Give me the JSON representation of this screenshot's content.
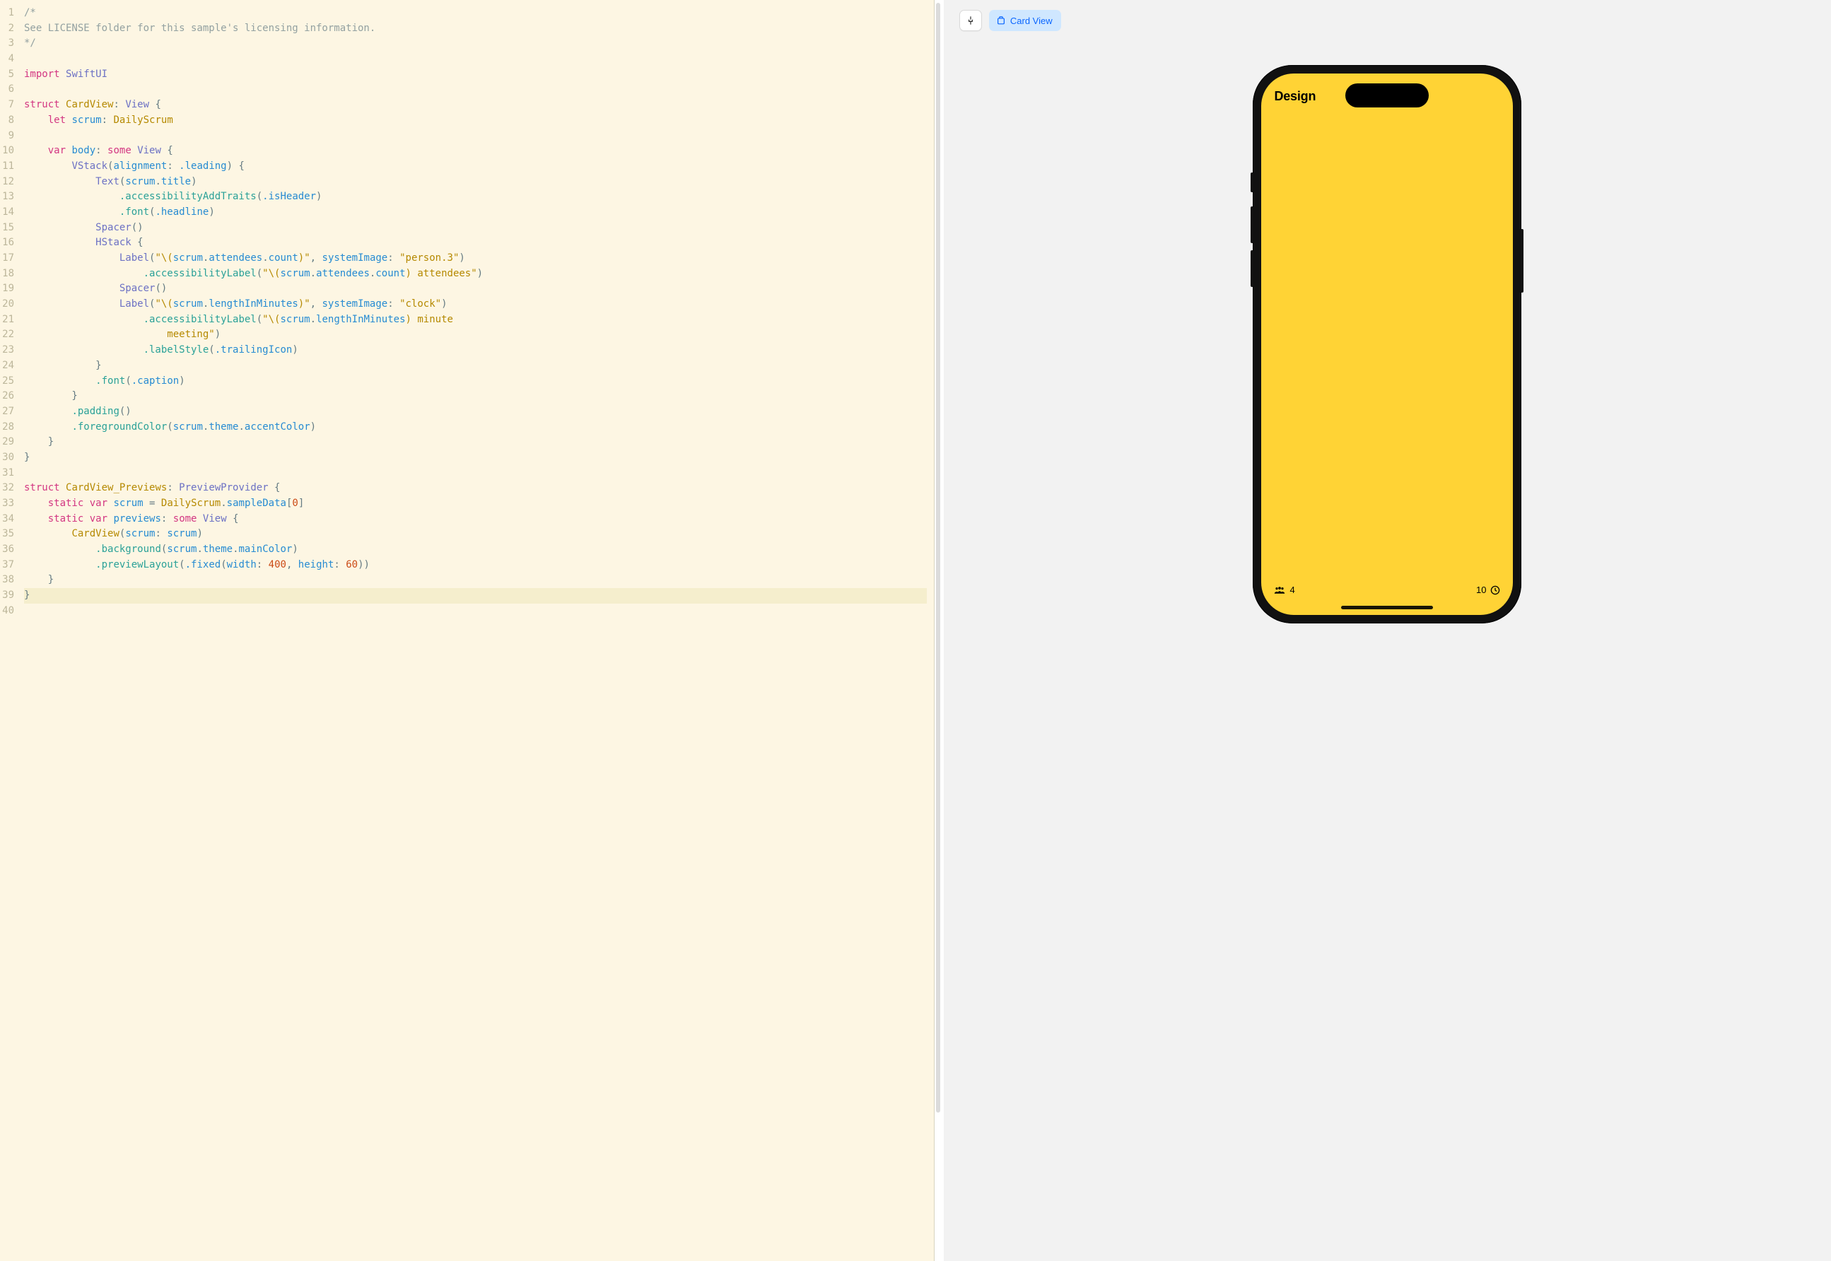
{
  "editor": {
    "lineCount": 39,
    "highlightLine": 39,
    "lines": [
      [
        [
          "c-comment",
          "/*"
        ]
      ],
      [
        [
          "c-comment",
          "See LICENSE folder for this sample's licensing information."
        ]
      ],
      [
        [
          "c-comment",
          "*/"
        ]
      ],
      [],
      [
        [
          "c-keyword",
          "import"
        ],
        [
          "c-plain",
          " "
        ],
        [
          "c-type",
          "SwiftUI"
        ]
      ],
      [],
      [
        [
          "c-keyword",
          "struct"
        ],
        [
          "c-plain",
          " "
        ],
        [
          "c-name",
          "CardView"
        ],
        [
          "c-plain",
          ": "
        ],
        [
          "c-type",
          "View"
        ],
        [
          "c-plain",
          " {"
        ]
      ],
      [
        [
          "c-plain",
          "    "
        ],
        [
          "c-keyword",
          "let"
        ],
        [
          "c-plain",
          " "
        ],
        [
          "c-ident",
          "scrum"
        ],
        [
          "c-plain",
          ": "
        ],
        [
          "c-name",
          "DailyScrum"
        ]
      ],
      [],
      [
        [
          "c-plain",
          "    "
        ],
        [
          "c-keyword",
          "var"
        ],
        [
          "c-plain",
          " "
        ],
        [
          "c-ident",
          "body"
        ],
        [
          "c-plain",
          ": "
        ],
        [
          "c-keyword",
          "some"
        ],
        [
          "c-plain",
          " "
        ],
        [
          "c-type",
          "View"
        ],
        [
          "c-plain",
          " {"
        ]
      ],
      [
        [
          "c-plain",
          "        "
        ],
        [
          "c-type",
          "VStack"
        ],
        [
          "c-plain",
          "("
        ],
        [
          "c-ident",
          "alignment"
        ],
        [
          "c-plain",
          ": "
        ],
        [
          "c-enum",
          ".leading"
        ],
        [
          "c-plain",
          ") {"
        ]
      ],
      [
        [
          "c-plain",
          "            "
        ],
        [
          "c-type",
          "Text"
        ],
        [
          "c-plain",
          "("
        ],
        [
          "c-ident",
          "scrum"
        ],
        [
          "c-plain",
          "."
        ],
        [
          "c-ident",
          "title"
        ],
        [
          "c-plain",
          ")"
        ]
      ],
      [
        [
          "c-plain",
          "                "
        ],
        [
          "c-member",
          ".accessibilityAddTraits"
        ],
        [
          "c-plain",
          "("
        ],
        [
          "c-enum",
          ".isHeader"
        ],
        [
          "c-plain",
          ")"
        ]
      ],
      [
        [
          "c-plain",
          "                "
        ],
        [
          "c-member",
          ".font"
        ],
        [
          "c-plain",
          "("
        ],
        [
          "c-enum",
          ".headline"
        ],
        [
          "c-plain",
          ")"
        ]
      ],
      [
        [
          "c-plain",
          "            "
        ],
        [
          "c-type",
          "Spacer"
        ],
        [
          "c-plain",
          "()"
        ]
      ],
      [
        [
          "c-plain",
          "            "
        ],
        [
          "c-type",
          "HStack"
        ],
        [
          "c-plain",
          " {"
        ]
      ],
      [
        [
          "c-plain",
          "                "
        ],
        [
          "c-type",
          "Label"
        ],
        [
          "c-plain",
          "("
        ],
        [
          "c-string",
          "\"\\("
        ],
        [
          "c-ident",
          "scrum"
        ],
        [
          "c-plain",
          "."
        ],
        [
          "c-ident",
          "attendees"
        ],
        [
          "c-plain",
          "."
        ],
        [
          "c-ident",
          "count"
        ],
        [
          "c-string",
          ")\""
        ],
        [
          "c-plain",
          ", "
        ],
        [
          "c-ident",
          "systemImage"
        ],
        [
          "c-plain",
          ": "
        ],
        [
          "c-string",
          "\"person.3\""
        ],
        [
          "c-plain",
          ")"
        ]
      ],
      [
        [
          "c-plain",
          "                    "
        ],
        [
          "c-member",
          ".accessibilityLabel"
        ],
        [
          "c-plain",
          "("
        ],
        [
          "c-string",
          "\"\\("
        ],
        [
          "c-ident",
          "scrum"
        ],
        [
          "c-plain",
          "."
        ],
        [
          "c-ident",
          "attendees"
        ],
        [
          "c-plain",
          "."
        ],
        [
          "c-ident",
          "count"
        ],
        [
          "c-string",
          ") attendees\""
        ],
        [
          "c-plain",
          ")"
        ]
      ],
      [
        [
          "c-plain",
          "                "
        ],
        [
          "c-type",
          "Spacer"
        ],
        [
          "c-plain",
          "()"
        ]
      ],
      [
        [
          "c-plain",
          "                "
        ],
        [
          "c-type",
          "Label"
        ],
        [
          "c-plain",
          "("
        ],
        [
          "c-string",
          "\"\\("
        ],
        [
          "c-ident",
          "scrum"
        ],
        [
          "c-plain",
          "."
        ],
        [
          "c-ident",
          "lengthInMinutes"
        ],
        [
          "c-string",
          ")\""
        ],
        [
          "c-plain",
          ", "
        ],
        [
          "c-ident",
          "systemImage"
        ],
        [
          "c-plain",
          ": "
        ],
        [
          "c-string",
          "\"clock\""
        ],
        [
          "c-plain",
          ")"
        ]
      ],
      [
        [
          "c-plain",
          "                    "
        ],
        [
          "c-member",
          ".accessibilityLabel"
        ],
        [
          "c-plain",
          "("
        ],
        [
          "c-string",
          "\"\\("
        ],
        [
          "c-ident",
          "scrum"
        ],
        [
          "c-plain",
          "."
        ],
        [
          "c-ident",
          "lengthInMinutes"
        ],
        [
          "c-string",
          ") minute "
        ]
      ],
      [
        [
          "c-string",
          "                        meeting\""
        ],
        [
          "c-plain",
          ")"
        ]
      ],
      [
        [
          "c-plain",
          "                    "
        ],
        [
          "c-member",
          ".labelStyle"
        ],
        [
          "c-plain",
          "("
        ],
        [
          "c-enum",
          ".trailingIcon"
        ],
        [
          "c-plain",
          ")"
        ]
      ],
      [
        [
          "c-plain",
          "            }"
        ]
      ],
      [
        [
          "c-plain",
          "            "
        ],
        [
          "c-member",
          ".font"
        ],
        [
          "c-plain",
          "("
        ],
        [
          "c-enum",
          ".caption"
        ],
        [
          "c-plain",
          ")"
        ]
      ],
      [
        [
          "c-plain",
          "        }"
        ]
      ],
      [
        [
          "c-plain",
          "        "
        ],
        [
          "c-member",
          ".padding"
        ],
        [
          "c-plain",
          "()"
        ]
      ],
      [
        [
          "c-plain",
          "        "
        ],
        [
          "c-member",
          ".foregroundColor"
        ],
        [
          "c-plain",
          "("
        ],
        [
          "c-ident",
          "scrum"
        ],
        [
          "c-plain",
          "."
        ],
        [
          "c-ident",
          "theme"
        ],
        [
          "c-plain",
          "."
        ],
        [
          "c-ident",
          "accentColor"
        ],
        [
          "c-plain",
          ")"
        ]
      ],
      [
        [
          "c-plain",
          "    }"
        ]
      ],
      [
        [
          "c-plain",
          "}"
        ]
      ],
      [],
      [
        [
          "c-keyword",
          "struct"
        ],
        [
          "c-plain",
          " "
        ],
        [
          "c-name",
          "CardView_Previews"
        ],
        [
          "c-plain",
          ": "
        ],
        [
          "c-type",
          "PreviewProvider"
        ],
        [
          "c-plain",
          " {"
        ]
      ],
      [
        [
          "c-plain",
          "    "
        ],
        [
          "c-keyword",
          "static"
        ],
        [
          "c-plain",
          " "
        ],
        [
          "c-keyword",
          "var"
        ],
        [
          "c-plain",
          " "
        ],
        [
          "c-ident",
          "scrum"
        ],
        [
          "c-plain",
          " = "
        ],
        [
          "c-name",
          "DailyScrum"
        ],
        [
          "c-plain",
          "."
        ],
        [
          "c-ident",
          "sampleData"
        ],
        [
          "c-plain",
          "["
        ],
        [
          "c-number",
          "0"
        ],
        [
          "c-plain",
          "]"
        ]
      ],
      [
        [
          "c-plain",
          "    "
        ],
        [
          "c-keyword",
          "static"
        ],
        [
          "c-plain",
          " "
        ],
        [
          "c-keyword",
          "var"
        ],
        [
          "c-plain",
          " "
        ],
        [
          "c-ident",
          "previews"
        ],
        [
          "c-plain",
          ": "
        ],
        [
          "c-keyword",
          "some"
        ],
        [
          "c-plain",
          " "
        ],
        [
          "c-type",
          "View"
        ],
        [
          "c-plain",
          " {"
        ]
      ],
      [
        [
          "c-plain",
          "        "
        ],
        [
          "c-name",
          "CardView"
        ],
        [
          "c-plain",
          "("
        ],
        [
          "c-ident",
          "scrum"
        ],
        [
          "c-plain",
          ": "
        ],
        [
          "c-ident",
          "scrum"
        ],
        [
          "c-plain",
          ")"
        ]
      ],
      [
        [
          "c-plain",
          "            "
        ],
        [
          "c-member",
          ".background"
        ],
        [
          "c-plain",
          "("
        ],
        [
          "c-ident",
          "scrum"
        ],
        [
          "c-plain",
          "."
        ],
        [
          "c-ident",
          "theme"
        ],
        [
          "c-plain",
          "."
        ],
        [
          "c-ident",
          "mainColor"
        ],
        [
          "c-plain",
          ")"
        ]
      ],
      [
        [
          "c-plain",
          "            "
        ],
        [
          "c-member",
          ".previewLayout"
        ],
        [
          "c-plain",
          "("
        ],
        [
          "c-enum",
          ".fixed"
        ],
        [
          "c-plain",
          "("
        ],
        [
          "c-ident",
          "width"
        ],
        [
          "c-plain",
          ": "
        ],
        [
          "c-number",
          "400"
        ],
        [
          "c-plain",
          ", "
        ],
        [
          "c-ident",
          "height"
        ],
        [
          "c-plain",
          ": "
        ],
        [
          "c-number",
          "60"
        ],
        [
          "c-plain",
          "))"
        ]
      ],
      [
        [
          "c-plain",
          "    }"
        ]
      ],
      [
        [
          "c-plain",
          "}"
        ]
      ],
      []
    ]
  },
  "canvas": {
    "chipLabel": "Card View",
    "preview": {
      "title": "Design",
      "attendees": "4",
      "minutes": "10"
    }
  }
}
